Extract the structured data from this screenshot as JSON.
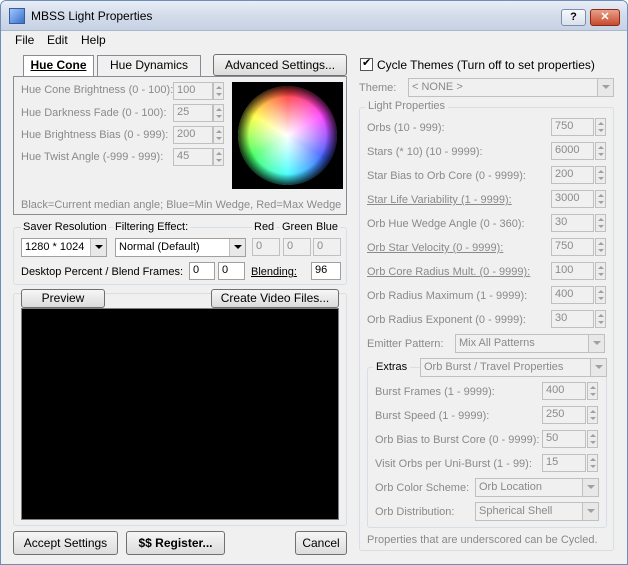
{
  "window": {
    "title": "MBSS Light Properties",
    "help_label": "?",
    "close_label": "✕"
  },
  "menu": [
    "File",
    "Edit",
    "Help"
  ],
  "tabs": [
    {
      "label": "Hue Cone",
      "active": true
    },
    {
      "label": "Hue Dynamics",
      "active": false
    }
  ],
  "advanced_button": "Advanced Settings...",
  "hue_fields": [
    {
      "label": "Hue Cone Brightness (0 - 100):",
      "value": "100"
    },
    {
      "label": "Hue Darkness Fade (0 - 100):",
      "value": "25"
    },
    {
      "label": "Hue Brightness Bias (0 - 999):",
      "value": "200"
    },
    {
      "label": "Hue Twist Angle (-999 - 999):",
      "value": "45"
    }
  ],
  "hue_legend": "Black=Current median angle; Blue=Min Wedge, Red=Max Wedge",
  "render": {
    "saver_resolution_label": "Saver Resolution",
    "saver_resolution_value": "1280 * 1024",
    "filtering_label": "Filtering Effect:",
    "filtering_value": "Normal (Default)",
    "red_label": "Red",
    "green_label": "Green",
    "blue_label": "Blue",
    "red_value": "0",
    "green_value": "0",
    "blue_value": "0",
    "desktop_label": "Desktop Percent / Blend Frames:",
    "desktop_value": "0",
    "blend_frames_value": "0",
    "blending_label": "Blending:",
    "blending_value": "96"
  },
  "preview": {
    "preview_button": "Preview",
    "create_video_button": "Create Video Files..."
  },
  "bottom_buttons": {
    "accept": "Accept Settings",
    "register": "$$  Register...",
    "cancel": "Cancel"
  },
  "cycle_themes": {
    "label": "Cycle Themes (Turn off to set properties)",
    "checked": true,
    "theme_label": "Theme:",
    "theme_value": "< NONE >"
  },
  "light_properties": {
    "group_label": "Light Properties",
    "fields": [
      {
        "label": "Orbs (10 - 999):",
        "value": "750",
        "underline": false
      },
      {
        "label": "Stars (* 10) (10 - 9999):",
        "value": "6000",
        "underline": false
      },
      {
        "label": "Star Bias to Orb Core (0 - 9999):",
        "value": "200",
        "underline": false
      },
      {
        "label": "Star Life Variability (1 - 9999):",
        "value": "3000",
        "underline": true
      },
      {
        "label": "Orb Hue Wedge Angle (0 - 360):",
        "value": "30",
        "underline": false
      },
      {
        "label": "Orb Star Velocity (0 - 9999):",
        "value": "750",
        "underline": true
      },
      {
        "label": "Orb Core Radius Mult. (0 - 9999):",
        "value": "100",
        "underline": true
      },
      {
        "label": "Orb Radius Maximum (1 - 9999):",
        "value": "400",
        "underline": false
      },
      {
        "label": "Orb Radius Exponent (0 - 9999):",
        "value": "30",
        "underline": false
      }
    ],
    "emitter_label": "Emitter Pattern:",
    "emitter_value": "Mix All Patterns",
    "extras_label": "Extras",
    "extras_value": "Orb Burst / Travel Properties",
    "extras_fields": [
      {
        "label": "Burst Frames (1 - 9999):",
        "value": "400"
      },
      {
        "label": "Burst Speed (1 - 9999):",
        "value": "250"
      },
      {
        "label": "Orb Bias to Burst Core (0 - 9999):",
        "value": "50"
      },
      {
        "label": "Visit Orbs per Uni-Burst (1 - 99):",
        "value": "15"
      }
    ],
    "color_scheme_label": "Orb Color Scheme:",
    "color_scheme_value": "Orb Location",
    "distribution_label": "Orb Distribution:",
    "distribution_value": "Spherical Shell",
    "footer_note": "Properties that are underscored can be Cycled."
  }
}
